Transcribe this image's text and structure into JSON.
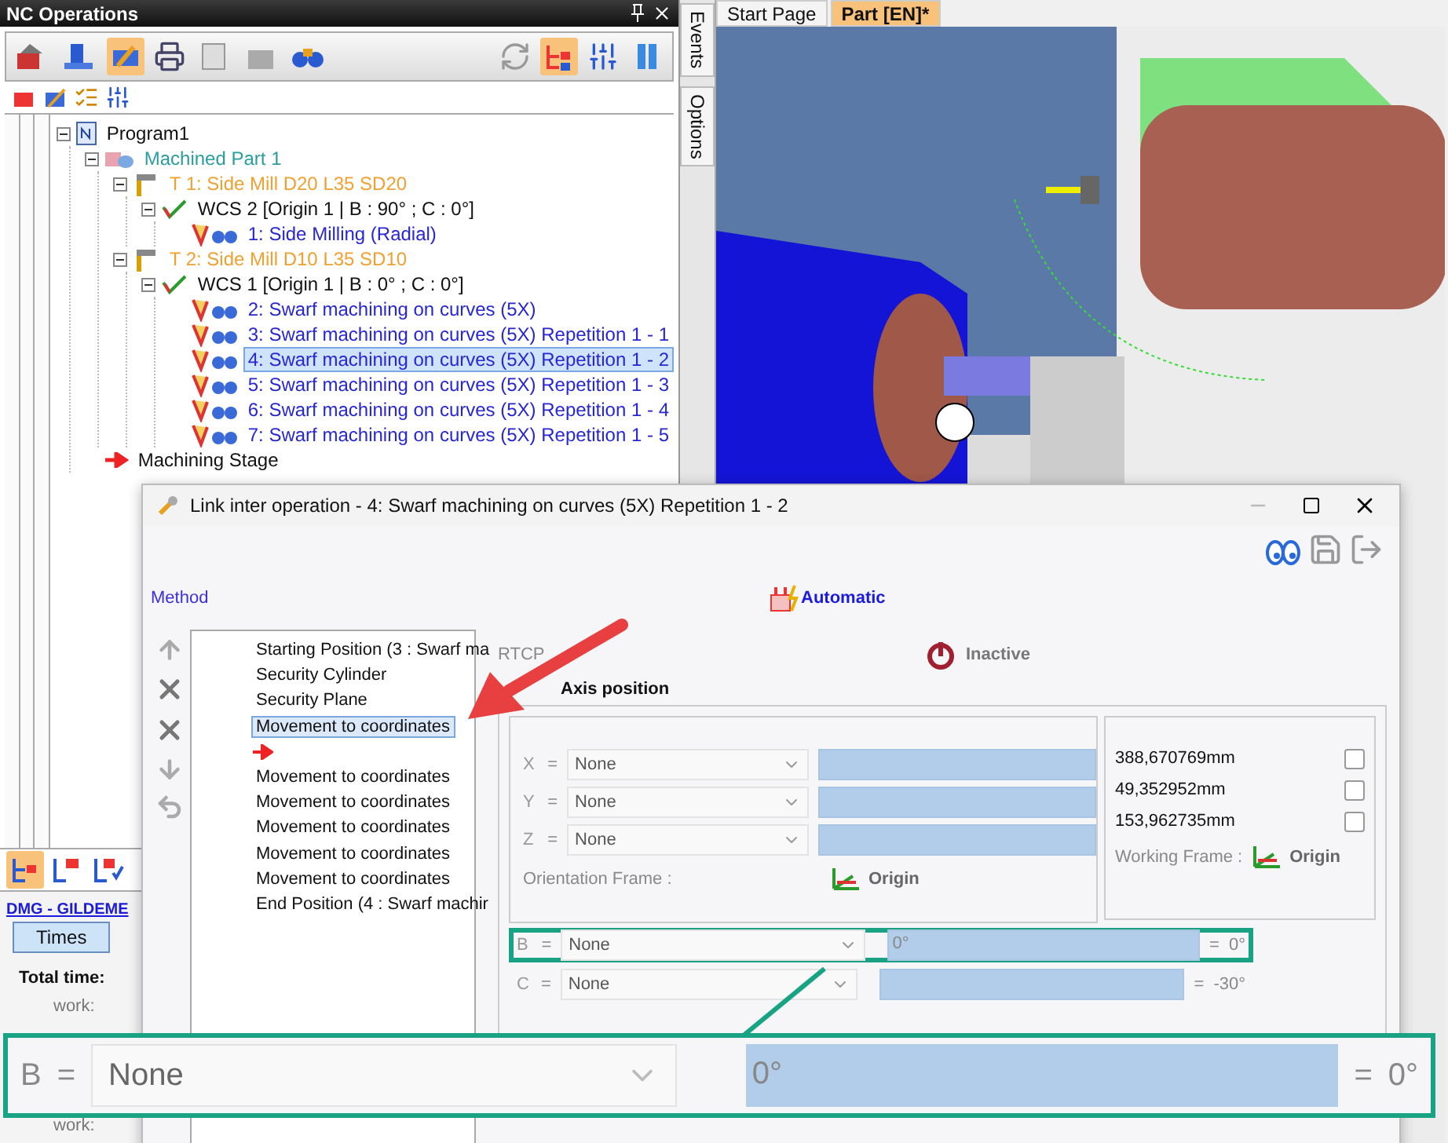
{
  "nc_panel": {
    "title": "NC Operations",
    "tree": [
      {
        "label": "Program1",
        "kind": "program",
        "expanded": true,
        "selected": false,
        "children": [
          {
            "label": "Machined Part 1",
            "kind": "part",
            "expanded": true,
            "selected": false,
            "children": [
              {
                "label": "T 1: Side Mill D20 L35 SD20",
                "kind": "tool",
                "expanded": true,
                "selected": false,
                "children": [
                  {
                    "label": "WCS 2 [Origin 1 | B : 90° ; C : 0°]",
                    "kind": "wcs",
                    "expanded": true,
                    "selected": false,
                    "children": [
                      {
                        "label": "1: Side Milling (Radial)",
                        "kind": "operation",
                        "selected": false
                      }
                    ]
                  }
                ]
              },
              {
                "label": "T 2: Side Mill D10 L35 SD10",
                "kind": "tool",
                "expanded": true,
                "selected": false,
                "children": [
                  {
                    "label": "WCS 1 [Origin 1 | B : 0° ; C : 0°]",
                    "kind": "wcs",
                    "expanded": true,
                    "selected": false,
                    "children": [
                      {
                        "label": "2: Swarf machining on curves (5X)",
                        "kind": "operation",
                        "selected": false
                      },
                      {
                        "label": "3: Swarf machining on curves (5X) Repetition 1 - 1",
                        "kind": "operation",
                        "selected": false
                      },
                      {
                        "label": "4: Swarf machining on curves (5X) Repetition 1 - 2",
                        "kind": "operation",
                        "selected": true
                      },
                      {
                        "label": "5: Swarf machining on curves (5X) Repetition 1 - 3",
                        "kind": "operation",
                        "selected": false
                      },
                      {
                        "label": "6: Swarf machining on curves (5X) Repetition 1 - 4",
                        "kind": "operation",
                        "selected": false
                      },
                      {
                        "label": "7: Swarf machining on curves (5X) Repetition 1 - 5",
                        "kind": "operation",
                        "selected": false
                      }
                    ]
                  }
                ]
              }
            ]
          },
          {
            "label": "Machining Stage",
            "kind": "stage",
            "selected": false
          }
        ]
      }
    ]
  },
  "machine_panel": {
    "link": "DMG - GILDEME",
    "tabs": [
      {
        "label": "Times",
        "selected": true
      }
    ],
    "total_label": "Total time:",
    "work_labels": [
      "work:",
      "work:"
    ]
  },
  "side_tabs": [
    {
      "label": "Events"
    },
    {
      "label": "Options"
    }
  ],
  "doc_tabs": [
    {
      "label": "Start Page",
      "selected": false
    },
    {
      "label": "Part [EN]*",
      "selected": true
    }
  ],
  "dialog": {
    "title": "Link inter operation - 4: Swarf machining on curves (5X) Repetition 1 - 2",
    "method_label": "Method",
    "method_value": "Automatic",
    "steps": [
      {
        "kind": "step",
        "label": "Starting Position (3 : Swarf ma",
        "selected": false
      },
      {
        "kind": "step",
        "label": "Security Cylinder",
        "selected": false
      },
      {
        "kind": "step",
        "label": "Security Plane",
        "selected": false
      },
      {
        "kind": "step",
        "label": "Movement to coordinates",
        "selected": true
      },
      {
        "kind": "insert",
        "selected": false
      },
      {
        "kind": "step",
        "label": "Movement to coordinates",
        "selected": false
      },
      {
        "kind": "step",
        "label": "Movement to coordinates",
        "selected": false
      },
      {
        "kind": "step",
        "label": "Movement to coordinates",
        "selected": false
      },
      {
        "kind": "step",
        "label": "Movement to coordinates",
        "selected": false
      },
      {
        "kind": "step",
        "label": "Movement to coordinates",
        "selected": false
      },
      {
        "kind": "step",
        "label": "End Position (4 : Swarf machir",
        "selected": false
      }
    ],
    "rtcp_label": "RTCP",
    "rtcp_value": "Inactive",
    "group_title": "Axis position",
    "linear_axes": [
      {
        "axis": "X",
        "sign": "=",
        "mode": "None",
        "reading": "388,670769mm",
        "checked": false
      },
      {
        "axis": "Y",
        "sign": "=",
        "mode": "None",
        "reading": "49,352952mm",
        "checked": false
      },
      {
        "axis": "Z",
        "sign": "=",
        "mode": "None",
        "reading": "153,962735mm",
        "checked": false
      }
    ],
    "orientation_label": "Orientation Frame :",
    "orientation_value": "Origin",
    "working_label": "Working Frame :",
    "working_value": "Origin",
    "rotary_axes": [
      {
        "axis": "B",
        "sign": "=",
        "mode": "None",
        "value": "0°",
        "result_sign": "=",
        "result": "0°",
        "highlighted": true
      },
      {
        "axis": "C",
        "sign": "=",
        "mode": "None",
        "result_sign": "=",
        "result": "-30°",
        "highlighted": false
      }
    ]
  },
  "callout": {
    "axis": "B",
    "sign": "=",
    "mode": "None",
    "value": "0°",
    "result_sign": "=",
    "result": "0°"
  }
}
